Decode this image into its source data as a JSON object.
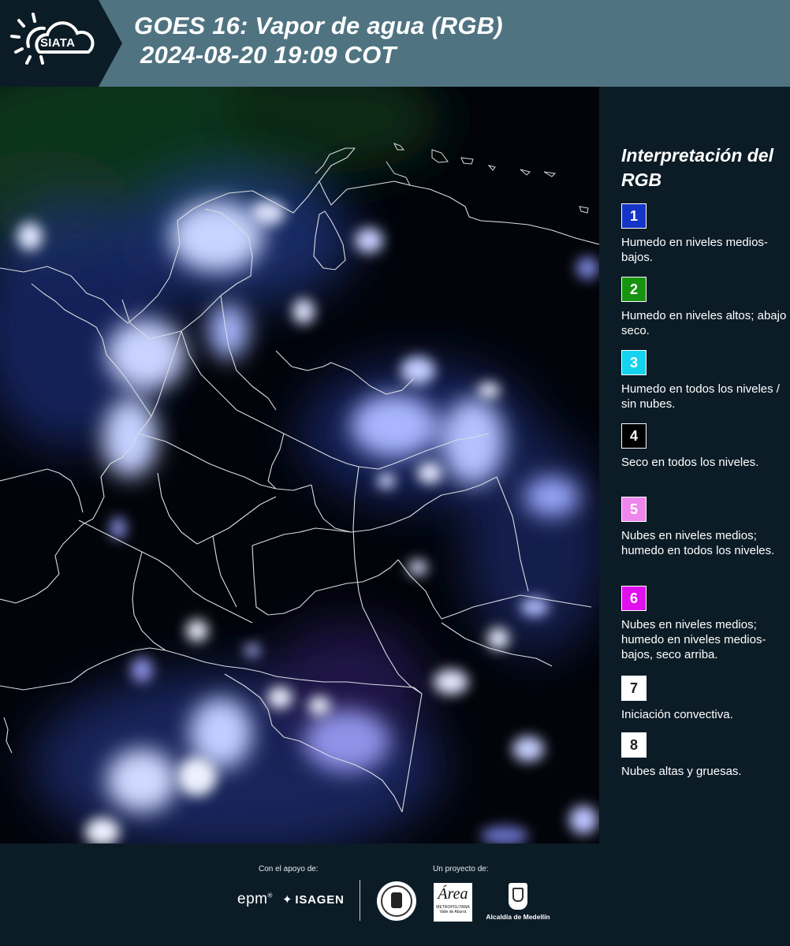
{
  "header": {
    "logo_text": "SIATA",
    "title_line1": "GOES 16: Vapor de agua (RGB)",
    "title_line2": "2024-08-20 19:09 COT",
    "background_color": "#4f7381",
    "logo_tab_color": "#0c1c27"
  },
  "map": {
    "description_icon": "satellite-map",
    "background_color": "#02040a",
    "border_color": "#d9dde0"
  },
  "legend": {
    "title": "Interpretación del RGB",
    "items": [
      {
        "number": "1",
        "color": "#1535c8",
        "text": "Humedo en niveles medios-bajos."
      },
      {
        "number": "2",
        "color": "#169410",
        "text": "Humedo en niveles altos; abajo seco."
      },
      {
        "number": "3",
        "color": "#14d3ee",
        "text": "Humedo en todos los niveles / sin nubes."
      },
      {
        "number": "4",
        "color": "#000000",
        "text": "Seco en todos los niveles."
      },
      {
        "number": "5",
        "color": "#ef86ec",
        "text": "Nubes en niveles medios; humedo en todos los niveles."
      },
      {
        "number": "6",
        "color": "#e00fee",
        "text": "Nubes en niveles medios; humedo en niveles medios-bajos, seco arriba."
      },
      {
        "number": "7",
        "color": "#ffffff",
        "text": "Iniciación convectiva."
      },
      {
        "number": "8",
        "color": "#ffffff",
        "text": "Nubes altas y gruesas."
      }
    ]
  },
  "footer": {
    "support_label": "Con el apoyo de:",
    "project_label": "Un proyecto de:",
    "sponsor_epm": "epm",
    "sponsor_epm_mark": "®",
    "sponsor_isagen": "ISAGEN",
    "area_logo_word": "Área",
    "area_logo_sub1": "METROPOLITANA",
    "area_logo_sub2": "Valle de Aburrá",
    "medellin_label": "Alcaldía de Medellín"
  }
}
